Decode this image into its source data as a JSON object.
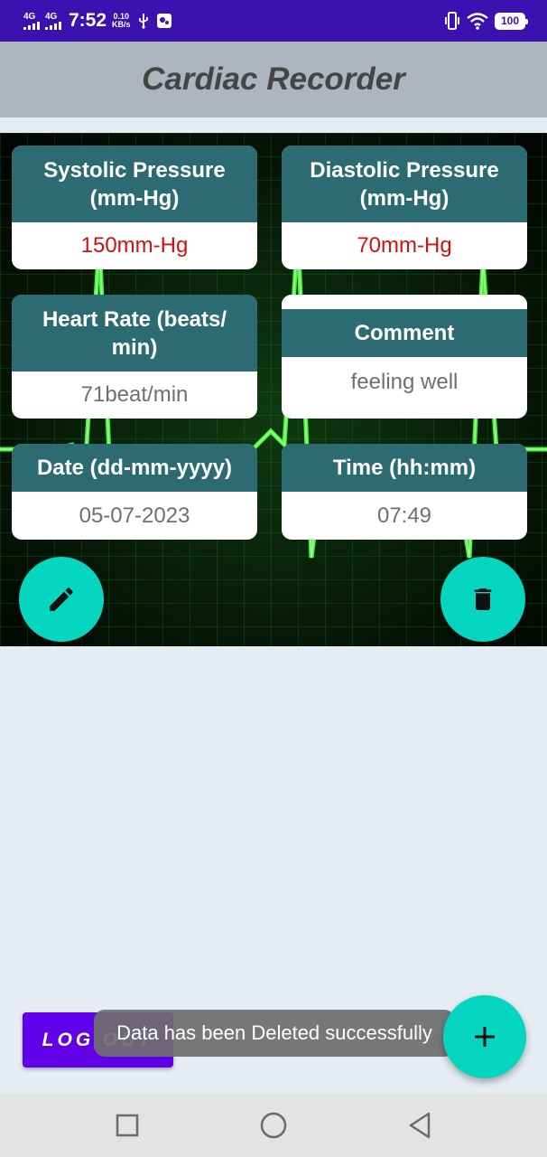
{
  "status_bar": {
    "sim1": "4G",
    "sim2": "4G",
    "time": "7:52",
    "speed_value": "0.10",
    "speed_unit": "KB/s",
    "battery": "100"
  },
  "app": {
    "title": "Cardiac Recorder"
  },
  "record": {
    "systolic": {
      "label": "Systolic Pressure (mm-Hg)",
      "value": "150mm-Hg"
    },
    "diastolic": {
      "label": "Diastolic Pressure (mm-Hg)",
      "value": "70mm-Hg"
    },
    "heart_rate": {
      "label": "Heart Rate (beats/ min)",
      "value": "71beat/min"
    },
    "comment": {
      "label": "Comment",
      "value": "feeling well"
    },
    "date": {
      "label": "Date (dd-mm-yyyy)",
      "value": "05-07-2023"
    },
    "time": {
      "label": "Time (hh:mm)",
      "value": "07:49"
    }
  },
  "buttons": {
    "edit_icon": "pencil-icon",
    "delete_icon": "trash-icon",
    "logout": "LOG OUT",
    "add_icon": "plus-icon"
  },
  "toast": {
    "message": "Data has been Deleted successfully"
  },
  "colors": {
    "status_bar": "#3b12b0",
    "title_bar": "#aeb5be",
    "card_header": "#2c6b71",
    "value_red": "#d31010",
    "fab": "#05d6c0",
    "logout": "#6200ea"
  }
}
